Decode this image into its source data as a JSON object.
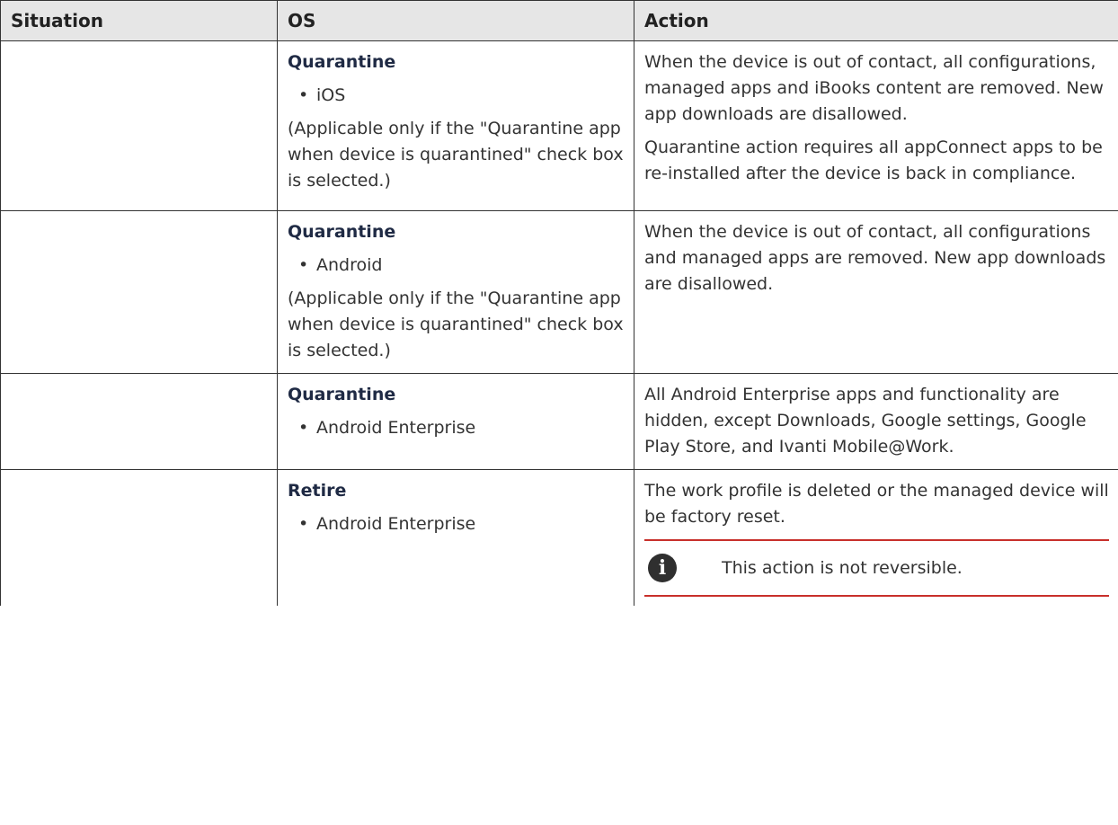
{
  "table": {
    "headers": [
      "Situation",
      "OS",
      "Action"
    ],
    "rows": [
      {
        "situation": "",
        "os_title": "Quarantine",
        "os_items": [
          "iOS"
        ],
        "os_note": "(Applicable only if the \"Quarantine app when device is quarantined\" check box is selected.)",
        "action_paragraphs": [
          "When the device is out of contact, all configurations, managed apps and iBooks content are removed. New app downloads are disallowed.",
          "Quarantine action requires all appConnect apps to be re-installed after the device is back in compliance."
        ]
      },
      {
        "situation": "",
        "os_title": "Quarantine",
        "os_items": [
          "Android"
        ],
        "os_note": "(Applicable only if the \"Quarantine app when device is quarantined\" check box is selected.)",
        "action_paragraphs": [
          "When the device is out of contact, all configurations and managed apps are removed. New app downloads are disallowed."
        ]
      },
      {
        "situation": "",
        "os_title": "Quarantine",
        "os_items": [
          "Android Enterprise"
        ],
        "os_note": "",
        "action_paragraphs": [
          "All Android Enterprise apps and functionality are hidden, except Downloads, Google settings, Google Play Store, and Ivanti Mobile@Work."
        ]
      },
      {
        "situation": "",
        "os_title": "Retire",
        "os_items": [
          "Android Enterprise"
        ],
        "os_note": "",
        "action_paragraphs": [
          "The work profile is deleted or the managed device will be factory reset."
        ],
        "note": {
          "icon": "info-icon",
          "icon_glyph": "i",
          "text": "This action is not reversible."
        }
      }
    ]
  },
  "colors": {
    "header_bg": "#e6e6e6",
    "note_rule": "#c8302b",
    "os_title": "#1f2a44"
  },
  "bullet_glyph": "•"
}
